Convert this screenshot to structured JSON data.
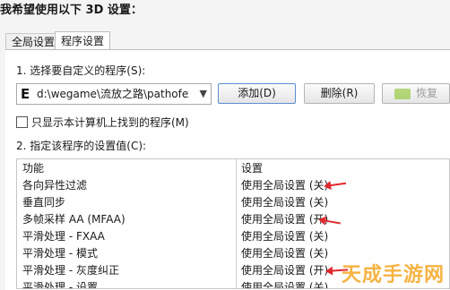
{
  "header": {
    "title": "我希望使用以下 3D 设置："
  },
  "tabs": [
    {
      "label": "全局设置",
      "active": false
    },
    {
      "label": "程序设置",
      "active": true
    }
  ],
  "section1": {
    "label": "1. 选择要自定义的程序(S):"
  },
  "program_select": {
    "icon": "E",
    "value": "d:\\wegame\\流放之路\\pathofexile..."
  },
  "buttons": {
    "add": "添加(D)",
    "delete": "删除(R)",
    "restore": "恢复"
  },
  "checkbox": {
    "label": "只显示本计算机上找到的程序(M)",
    "checked": false
  },
  "section2": {
    "label": "2. 指定该程序的设置值(C):"
  },
  "table": {
    "headers": {
      "feature": "功能",
      "setting": "设置"
    },
    "rows": [
      {
        "feature": "各向异性过滤",
        "setting": "使用全局设置 (关)"
      },
      {
        "feature": "垂直同步",
        "setting": "使用全局设置 (关)"
      },
      {
        "feature": "多帧采样 AA (MFAA)",
        "setting": "使用全局设置 (开)"
      },
      {
        "feature": "平滑处理 - FXAA",
        "setting": "使用全局设置 (关)"
      },
      {
        "feature": "平滑处理 - 模式",
        "setting": "使用全局设置 (关)"
      },
      {
        "feature": "平滑处理 - 灰度纠正",
        "setting": "使用全局设置 (开)"
      },
      {
        "feature": "平滑处理 - 设置",
        "setting": "使用全局设置 (关)"
      }
    ]
  },
  "watermark": "天成手游网",
  "colors": {
    "arrow": "#e0282d",
    "nvidia_green": "#76b900"
  }
}
